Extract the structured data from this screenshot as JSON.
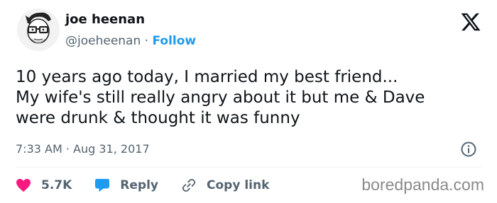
{
  "author": {
    "name": "joe heenan",
    "handle": "@joeheenan",
    "separator": "·",
    "follow_label": "Follow"
  },
  "tweet": {
    "lines": [
      "10 years ago today, I married my best friend...",
      "My wife's still really angry about it but me & Dave",
      "were drunk & thought it was funny"
    ],
    "time": "7:33 AM",
    "separator": "·",
    "date": "Aug 31, 2017"
  },
  "actions": {
    "likes_count": "5.7K",
    "reply_label": "Reply",
    "copy_link_label": "Copy link"
  },
  "watermark": "boredpanda.com",
  "icons": {
    "avatar": "cartoon-avatar-icon",
    "x_logo": "x-logo-icon",
    "info": "info-icon",
    "like": "heart-icon",
    "reply": "speech-bubble-icon",
    "copy_link": "link-icon"
  },
  "colors": {
    "follow": "#1d9bf0",
    "like": "#f91880",
    "reply": "#1d9bf0",
    "muted": "#536471",
    "text": "#0f1419"
  }
}
